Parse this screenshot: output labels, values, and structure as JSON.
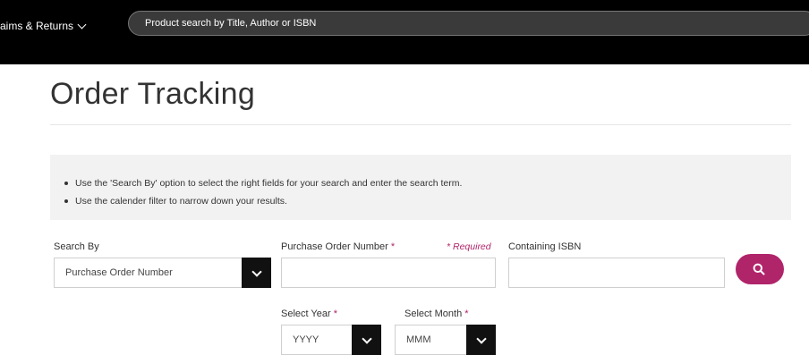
{
  "header": {
    "nav_item": "aims & Returns",
    "search_placeholder": "Product search by Title, Author or ISBN"
  },
  "page": {
    "title": "Order Tracking"
  },
  "info": {
    "bullets": [
      "Use the 'Search By' option to select the right fields for your search and enter the search term.",
      "Use the calender filter to narrow down your results."
    ]
  },
  "form": {
    "search_by": {
      "label": "Search By",
      "value": "Purchase Order Number"
    },
    "po_number": {
      "label": "Purchase Order Number",
      "asterisk": "*",
      "value": ""
    },
    "required_note": "* Required",
    "isbn": {
      "label": "Containing ISBN",
      "value": ""
    },
    "year": {
      "label": "Select Year",
      "asterisk": "*",
      "value": "YYYY"
    },
    "month": {
      "label": "Select Month",
      "asterisk": "*",
      "value": "MMM"
    },
    "search_icon": "search-icon"
  },
  "colors": {
    "accent": "#b0246a",
    "header_bg": "#000000",
    "info_bg": "#f2f2f2"
  }
}
